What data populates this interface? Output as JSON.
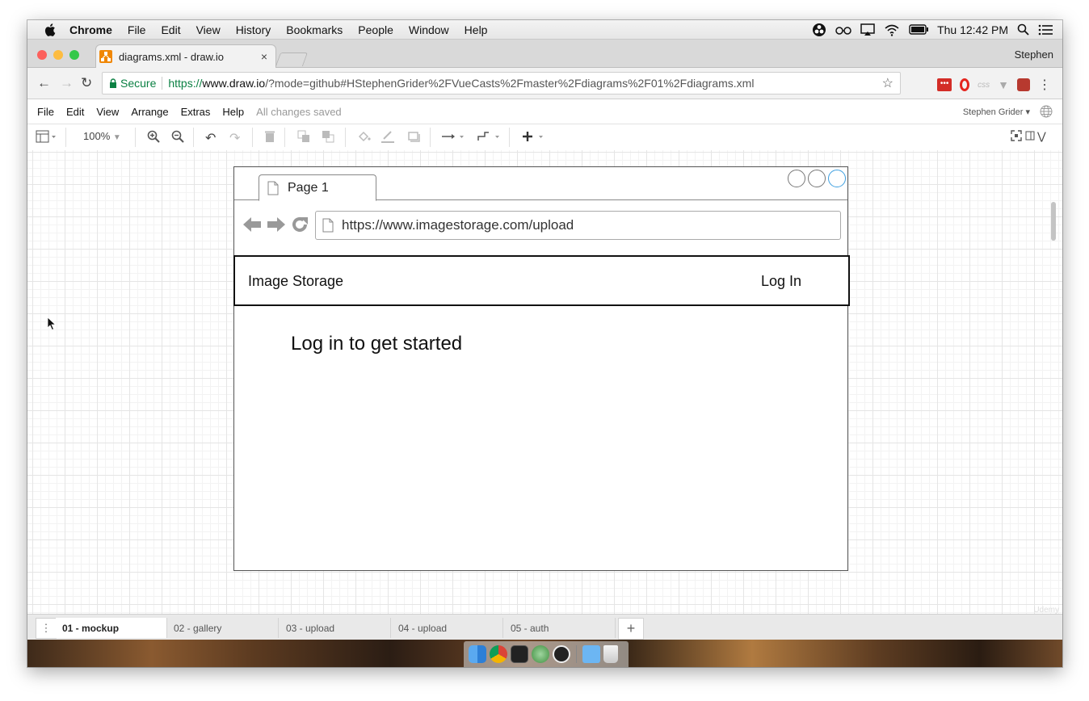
{
  "mac_menubar": {
    "app": "Chrome",
    "items": [
      "File",
      "Edit",
      "View",
      "History",
      "Bookmarks",
      "People",
      "Window",
      "Help"
    ],
    "clock": "Thu 12:42 PM"
  },
  "browser": {
    "tab_title": "diagrams.xml - draw.io",
    "tab_close": "×",
    "profile_name": "Stephen",
    "secure_label": "Secure",
    "url_scheme": "https://",
    "url_host": "www.draw.io",
    "url_rest": "/?mode=github#HStephenGrider%2FVueCasts%2Fmaster%2Fdiagrams%2F01%2Fdiagrams.xml",
    "ext_css_label": "css"
  },
  "drawio": {
    "menu": [
      "File",
      "Edit",
      "View",
      "Arrange",
      "Extras",
      "Help"
    ],
    "save_status": "All changes saved",
    "user": "Stephen Grider",
    "zoom": "100%"
  },
  "mockup": {
    "tab_label": "Page 1",
    "url": "https://www.imagestorage.com/upload",
    "brand": "Image Storage",
    "login": "Log In",
    "body_text": "Log in to get started"
  },
  "pages": [
    {
      "label": "01 - mockup",
      "active": true
    },
    {
      "label": "02 - gallery",
      "active": false
    },
    {
      "label": "03 - upload",
      "active": false
    },
    {
      "label": "04 - upload",
      "active": false
    },
    {
      "label": "05 - auth",
      "active": false
    }
  ],
  "add_page": "+",
  "watermark": "Udemy",
  "colors": {
    "secure_green": "#0b8043",
    "drawio_orange": "#f08705",
    "active_circle": "#3d9fe0"
  }
}
